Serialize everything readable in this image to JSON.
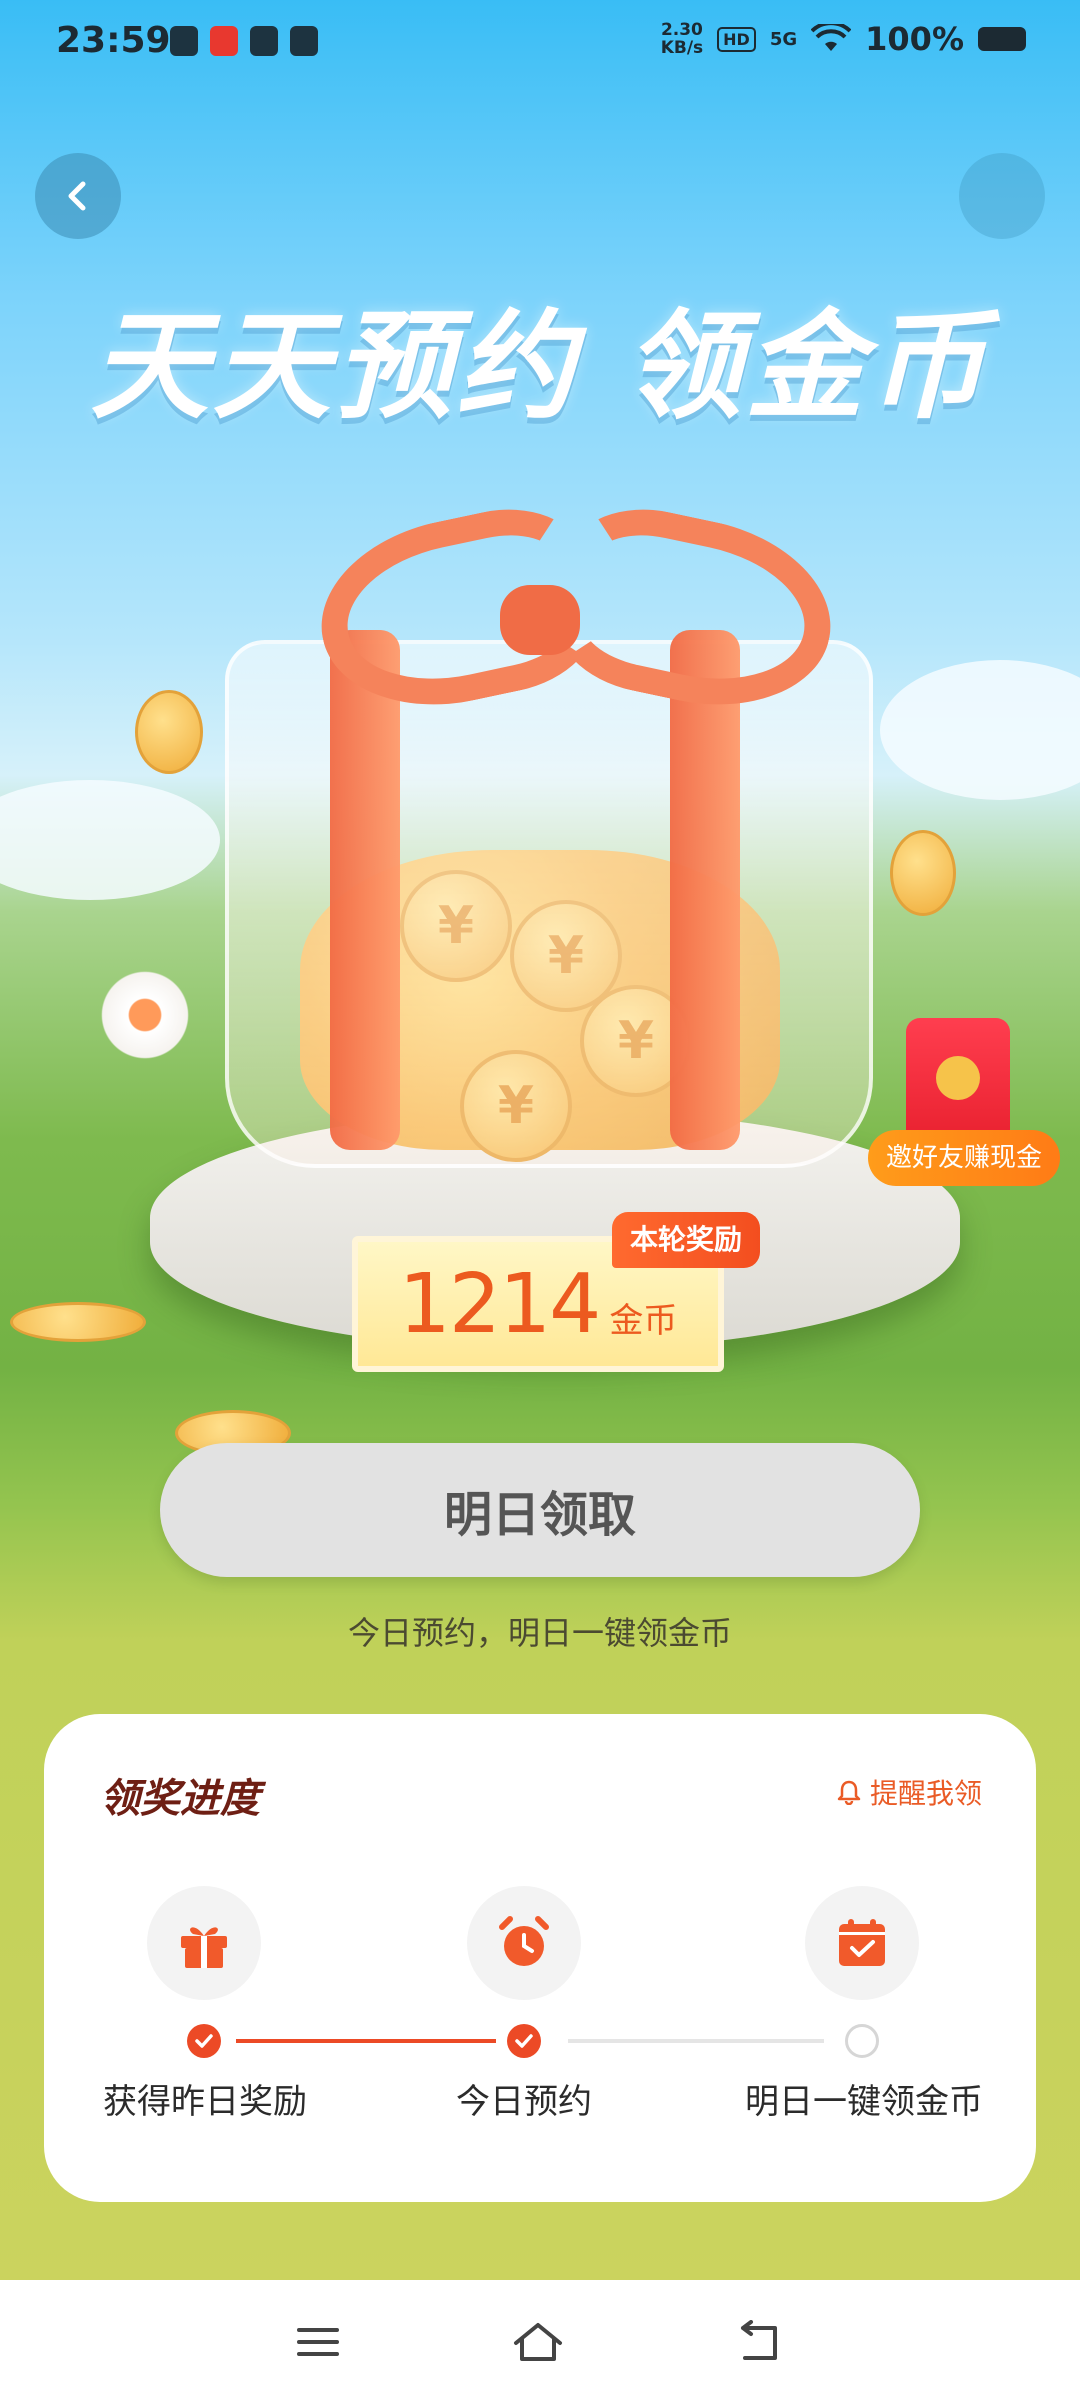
{
  "status_bar": {
    "time": "23:59",
    "net_speed": "2.30\nKB/s",
    "hd": "HD",
    "signal": "5G",
    "battery": "100%"
  },
  "header": {
    "headline": "天天预约 领金币"
  },
  "reward": {
    "tag": "本轮奖励",
    "amount": "1214",
    "unit": "金币"
  },
  "invite": {
    "label": "邀好友赚现金"
  },
  "action": {
    "button_label": "明日领取",
    "hint": "今日预约，明日一键领金币"
  },
  "progress": {
    "title": "领奖进度",
    "remind_label": "提醒我领",
    "steps": [
      {
        "label": "获得昨日奖励",
        "icon": "gift-icon",
        "done": true
      },
      {
        "label": "今日预约",
        "icon": "alarm-clock-icon",
        "done": true
      },
      {
        "label": "明日一键领金币",
        "icon": "calendar-check-icon",
        "done": false
      }
    ]
  },
  "colors": {
    "accent": "#ec4a26",
    "title": "#6e1f14",
    "card": "#ffffff"
  }
}
